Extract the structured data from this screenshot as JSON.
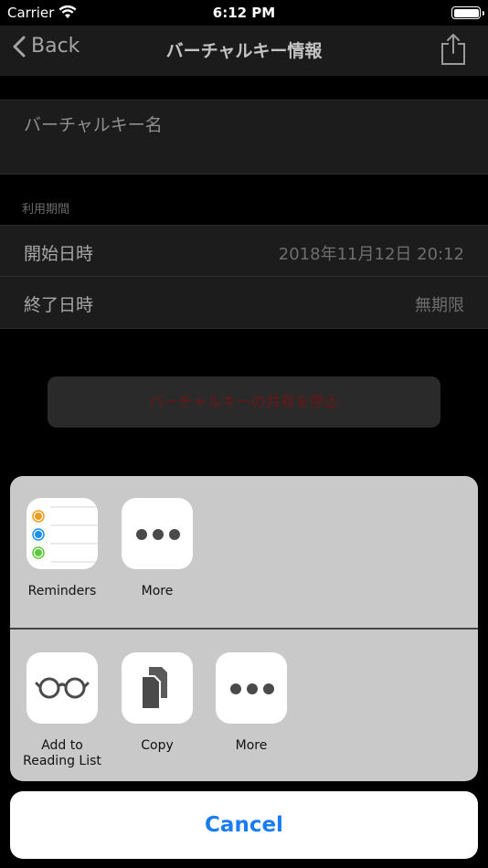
{
  "status_bar": {
    "carrier": "Carrier",
    "time": "6:12 PM"
  },
  "nav": {
    "back_label": "Back",
    "title": "バーチャルキー情報"
  },
  "form": {
    "name_placeholder": "バーチャルキー名",
    "section_label": "利用期間",
    "start_label": "開始日時",
    "start_value": "2018年11月12日 20:12",
    "end_label": "終了日時",
    "end_value": "無期限",
    "stop_button": "バーチャルキーの共有を停止"
  },
  "share_sheet": {
    "apps": [
      {
        "label": "Reminders",
        "icon": "reminders-icon"
      },
      {
        "label": "More",
        "icon": "more-icon"
      }
    ],
    "actions": [
      {
        "label": "Add to\nReading List",
        "icon": "reading-list-icon"
      },
      {
        "label": "Copy",
        "icon": "copy-icon"
      },
      {
        "label": "More",
        "icon": "more-icon"
      }
    ],
    "cancel": "Cancel"
  },
  "colors": {
    "accent": "#1a7cf2",
    "destructive_text": "#6b1616",
    "reminder_dots": [
      "#f09a1a",
      "#1a8ff0",
      "#5cc83a"
    ]
  }
}
